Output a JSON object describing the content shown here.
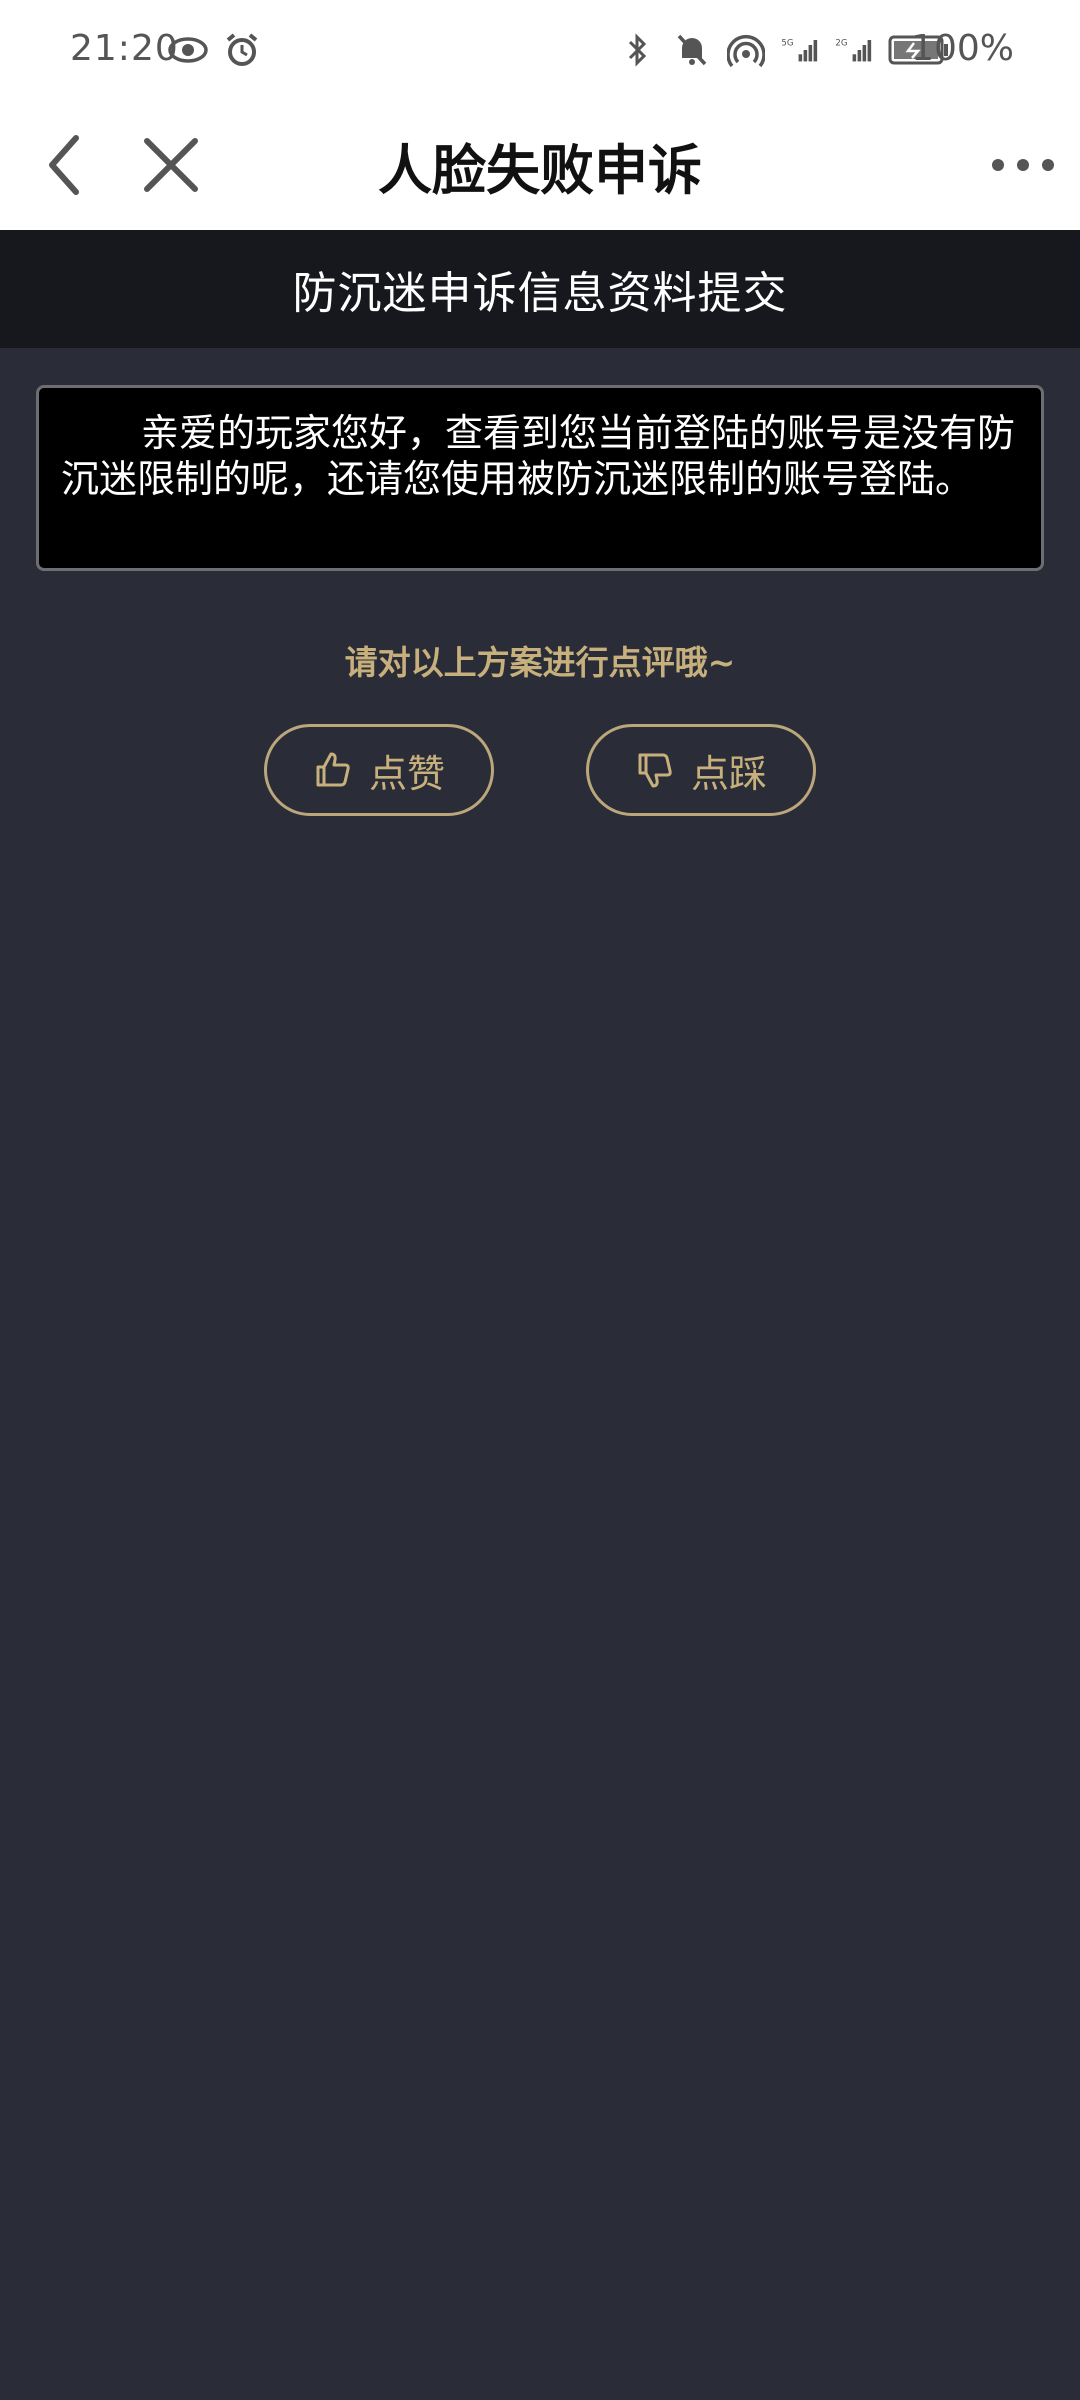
{
  "status_bar": {
    "time": "21:20",
    "battery": "100%",
    "icons": [
      "eye-icon",
      "alarm-icon",
      "bluetooth-icon",
      "mute-icon",
      "hotspot-icon",
      "signal-5g-icon",
      "signal-2g-icon",
      "battery-icon"
    ]
  },
  "nav": {
    "title": "人脸失败申诉",
    "icons": [
      "back-icon",
      "close-icon",
      "more-icon"
    ]
  },
  "section": {
    "title": "防沉迷申诉信息资料提交"
  },
  "message": {
    "text": "亲爱的玩家您好，查看到您当前登陆的账号是没有防沉迷限制的呢，还请您使用被防沉迷限制的账号登陆。"
  },
  "rating": {
    "prompt": "请对以上方案进行点评哦~",
    "like_label": "点赞",
    "dislike_label": "点踩"
  },
  "colors": {
    "background": "#2a2d38",
    "header_bar": "#17181d",
    "accent_gold": "#c7b07c",
    "message_bg": "#000000"
  }
}
